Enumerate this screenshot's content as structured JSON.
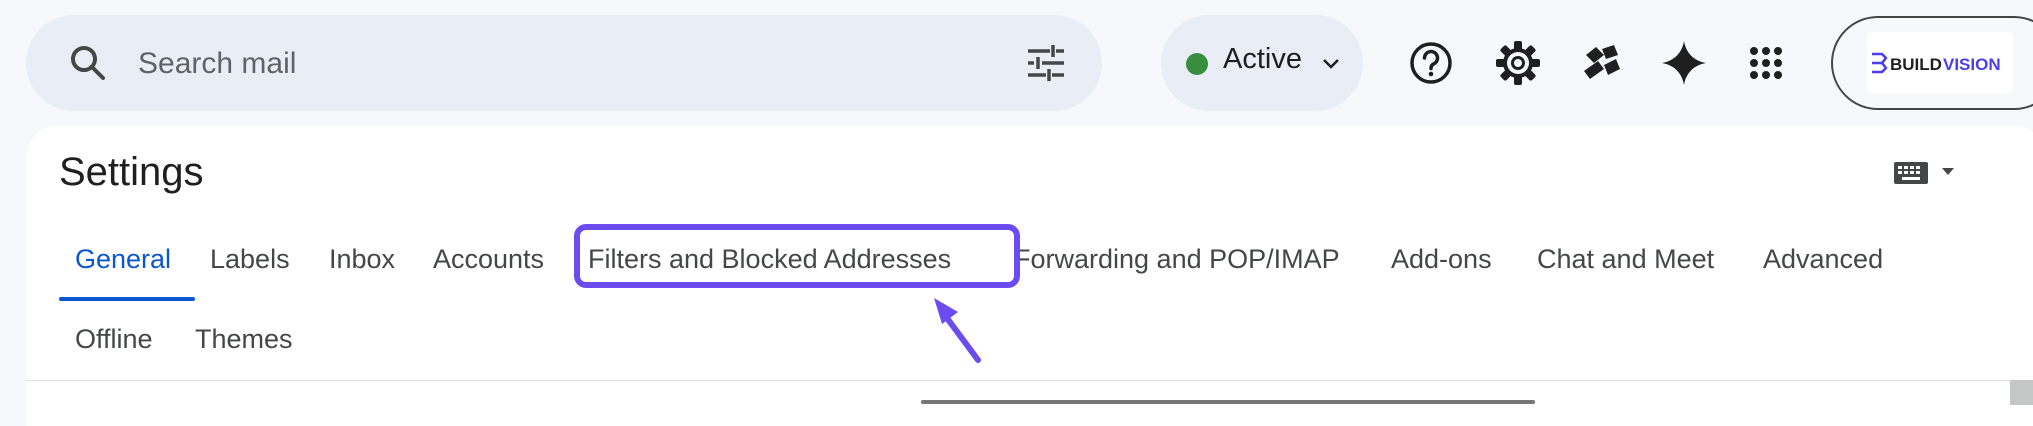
{
  "search": {
    "placeholder": "Search mail",
    "icon": "search-icon",
    "filter_icon": "tune-icon"
  },
  "status": {
    "label": "Active",
    "color": "#388e3c"
  },
  "header_icons": [
    "help-icon",
    "settings-icon",
    "app-launcher-mail-icon",
    "gemini-sparkle-icon",
    "apps-grid-icon"
  ],
  "account": {
    "org_logo_text": "BUILDVISION",
    "brand_color": "#4c3ee8"
  },
  "settings": {
    "title": "Settings",
    "tabs_row1": [
      "General",
      "Labels",
      "Inbox",
      "Accounts",
      "Filters and Blocked Addresses",
      "Forwarding and POP/IMAP",
      "Add-ons",
      "Chat and Meet",
      "Advanced"
    ],
    "tabs_row2": [
      "Offline",
      "Themes"
    ],
    "active_tab": "General",
    "highlighted_tab": "Filters and Blocked Addresses"
  },
  "colors": {
    "accent": "#0b57d0",
    "highlight": "#6c4cf1"
  }
}
